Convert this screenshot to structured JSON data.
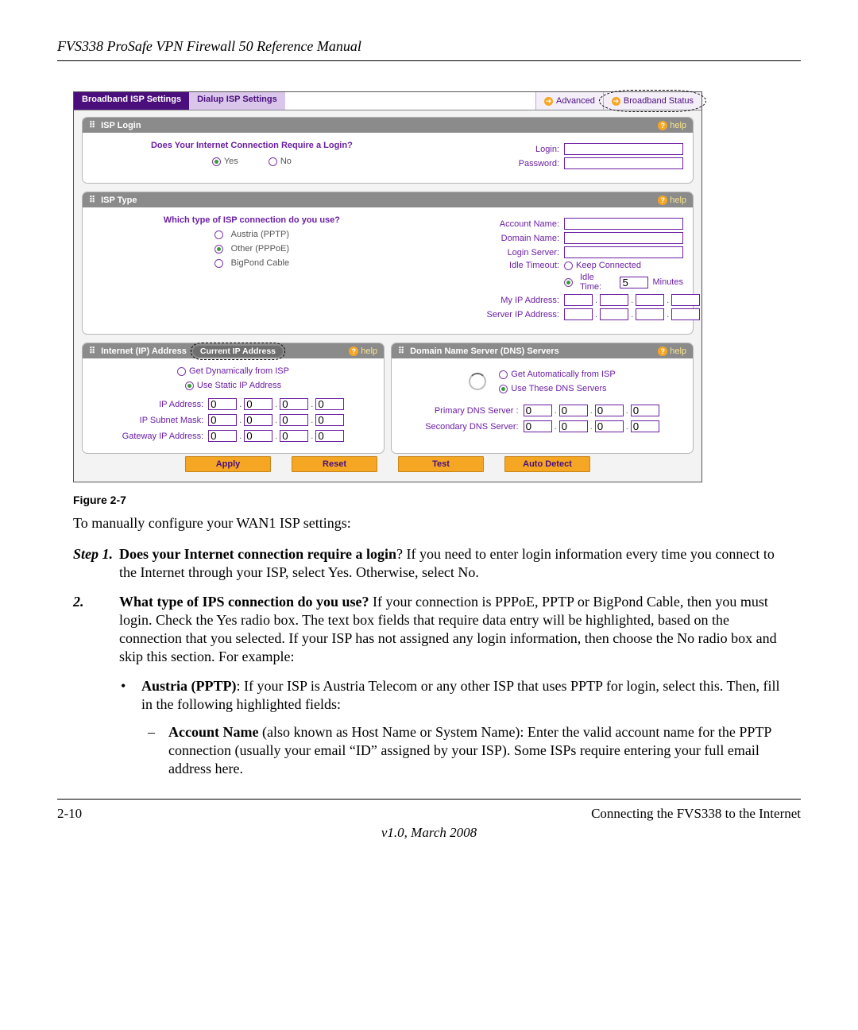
{
  "doc": {
    "header": "FVS338 ProSafe VPN Firewall 50 Reference Manual",
    "figure_caption": "Figure 2-7",
    "intro": "To manually configure your WAN1 ISP settings:",
    "step1_num": "Step 1.",
    "step1_bold": "Does your Internet connection require a login",
    "step1_rest": "? If you need to enter login information every time you connect to the Internet through your ISP, select Yes. Otherwise, select No.",
    "step2_num": "2.",
    "step2_bold": "What type of IPS connection do you use?",
    "step2_rest": " If your connection is PPPoE, PPTP or BigPond Cable, then you must login. Check the Yes radio box. The text box fields that require data entry will be highlighted, based on the connection that you selected. If your ISP has not assigned any login information, then choose the No radio box and skip this section. For example:",
    "sub1_bold": "Austria (PPTP)",
    "sub1_rest": ": If your ISP is Austria Telecom or any other ISP that uses PPTP for login, select this. Then, fill in the following highlighted fields:",
    "sub2_bold": "Account Name",
    "sub2_rest": " (also known as Host Name or System Name): Enter the valid account name for the PPTP connection (usually your email “ID” assigned by your ISP). Some ISPs require entering your full email address here.",
    "footer_left": "2-10",
    "footer_right": "Connecting the FVS338 to the Internet",
    "version": "v1.0, March 2008"
  },
  "ui": {
    "tabs": {
      "active": "Broadband ISP Settings",
      "inactive": "Dialup ISP Settings"
    },
    "links": {
      "advanced": "Advanced",
      "status": "Broadband Status"
    },
    "help": "help",
    "isp_login": {
      "title": "ISP Login",
      "question": "Does Your Internet Connection Require a Login?",
      "yes": "Yes",
      "no": "No",
      "login_label": "Login:",
      "password_label": "Password:"
    },
    "isp_type": {
      "title": "ISP Type",
      "question": "Which type of ISP connection do you use?",
      "opt_austria": "Austria (PPTP)",
      "opt_other": "Other (PPPoE)",
      "opt_bigpond": "BigPond Cable",
      "account_name": "Account Name:",
      "domain_name": "Domain Name:",
      "login_server": "Login Server:",
      "idle_timeout": "Idle Timeout:",
      "keep_connected": "Keep Connected",
      "idle_time": "Idle Time:",
      "idle_value": "5",
      "minutes": "Minutes",
      "my_ip": "My IP Address:",
      "server_ip": "Server IP Address:"
    },
    "ip": {
      "title": "Internet (IP) Address",
      "pill": "Current IP Address",
      "dyn": "Get Dynamically from ISP",
      "static": "Use Static IP Address",
      "ip_addr": "IP Address:",
      "subnet": "IP Subnet Mask:",
      "gateway": "Gateway IP Address:",
      "zero": "0"
    },
    "dns": {
      "title": "Domain Name Server (DNS) Servers",
      "auto": "Get Automatically from ISP",
      "manual": "Use These DNS Servers",
      "primary": "Primary DNS Server :",
      "secondary": "Secondary DNS Server:",
      "zero": "0"
    },
    "buttons": {
      "apply": "Apply",
      "reset": "Reset",
      "test": "Test",
      "auto": "Auto Detect"
    }
  }
}
